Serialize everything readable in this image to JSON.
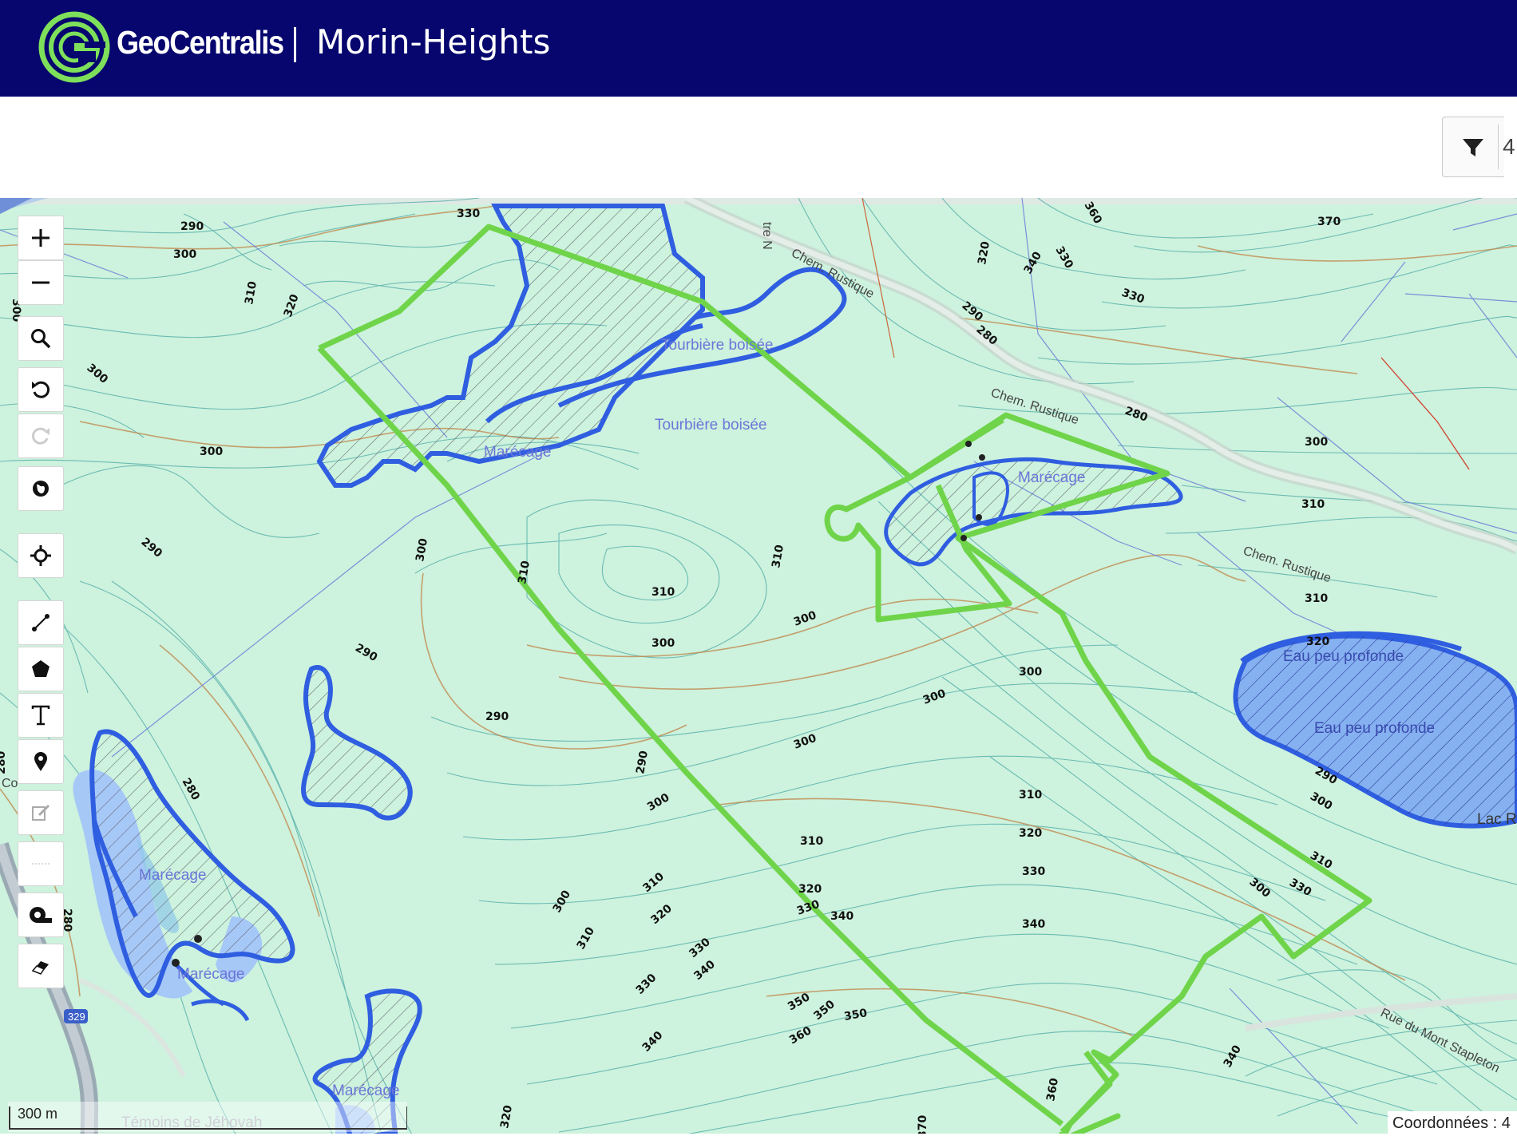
{
  "header": {
    "brand": "GeoCentralis",
    "city": "Morin-Heights"
  },
  "filter": {
    "icon": "filter-icon",
    "count": "4"
  },
  "map": {
    "background_color": "#cdf2dd",
    "parcel_outline_color": "#6fd44a",
    "wetland_outline_color": "#2f5ee0",
    "water_fill_color": "#a6c8f7",
    "scale_label": "300 m",
    "coordinates_label": "Coordonnées : 4",
    "labels": {
      "tourbiere_1": "Tourbière boisée",
      "tourbiere_2": "Tourbière boisée",
      "marecage_1": "Marécage",
      "marecage_2": "Marécage",
      "marecage_3": "Marécage",
      "marecage_4": "Marécage",
      "marecage_5": "Marécage",
      "eau_1": "Eau peu profonde",
      "eau_2": "Eau peu profonde",
      "chem_rustique_1": "Chem. Rustique",
      "chem_rustique_2": "Chem. Rustique",
      "chem_rustique_3": "Chem. Rustique",
      "rue_mont_stapleton": "Rue du Mont Stapleton",
      "lac": "Lac R",
      "route_329": "329",
      "temoins": "Témoins de Jéhovah",
      "street_n": "tre N",
      "co": "Co"
    },
    "contours": [
      "330",
      "290",
      "300",
      "300",
      "310",
      "320",
      "300",
      "300",
      "290",
      "310",
      "300",
      "310",
      "310",
      "300",
      "300",
      "290",
      "290",
      "280",
      "280",
      "280",
      "300",
      "300",
      "300",
      "310",
      "320",
      "330",
      "340",
      "350",
      "360",
      "370",
      "310",
      "320",
      "330",
      "340",
      "350",
      "340",
      "350",
      "340",
      "330",
      "320",
      "310",
      "300",
      "290",
      "300",
      "310",
      "320",
      "330",
      "340",
      "360",
      "290",
      "310",
      "300",
      "300",
      "330",
      "320",
      "310",
      "280",
      "280",
      "290",
      "300",
      "310",
      "320",
      "370",
      "330",
      "360",
      "330",
      "340"
    ]
  },
  "tools": [
    {
      "name": "zoom-in",
      "icon": "plus-icon"
    },
    {
      "name": "zoom-out",
      "icon": "minus-icon"
    },
    {
      "name": "search",
      "icon": "search-icon"
    },
    {
      "name": "undo",
      "icon": "undo-icon"
    },
    {
      "name": "redo",
      "icon": "redo-icon"
    },
    {
      "name": "basemap",
      "icon": "globe-icon"
    },
    {
      "name": "locate",
      "icon": "crosshair-icon"
    },
    {
      "name": "draw-line",
      "icon": "line-icon"
    },
    {
      "name": "draw-polygon",
      "icon": "polygon-icon"
    },
    {
      "name": "draw-text",
      "icon": "text-icon"
    },
    {
      "name": "draw-point",
      "icon": "marker-icon"
    },
    {
      "name": "edit",
      "icon": "edit-icon"
    },
    {
      "name": "separator-tool",
      "icon": "dots-icon"
    },
    {
      "name": "measure",
      "icon": "measure-tape-icon"
    },
    {
      "name": "erase",
      "icon": "eraser-icon"
    }
  ]
}
